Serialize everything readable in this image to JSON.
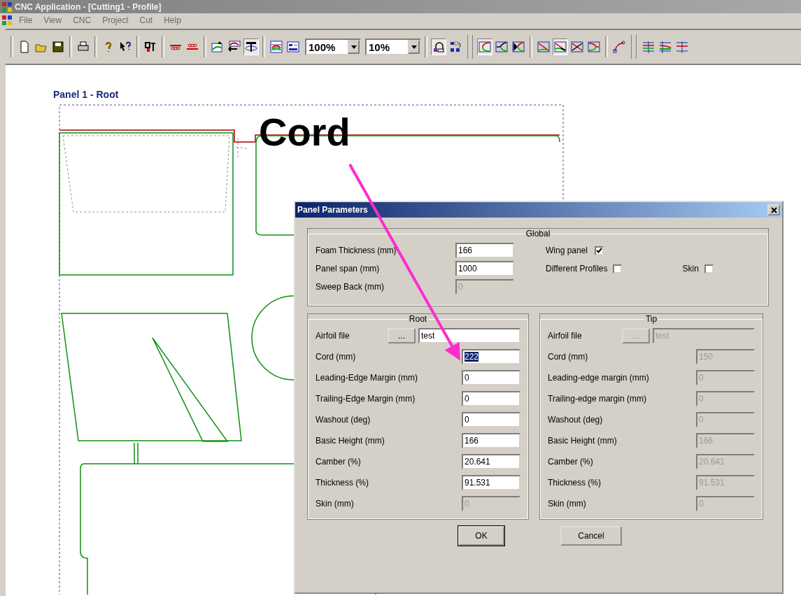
{
  "window": {
    "title": "CNC Application - [Cutting1 - Profile]"
  },
  "menu": [
    "File",
    "View",
    "CNC",
    "Project",
    "Cut",
    "Help"
  ],
  "toolbar": {
    "zoom": "100%",
    "step": "10%",
    "buttons": [
      {
        "pressed": false
      },
      {
        "pressed": false
      },
      {
        "pressed": false
      },
      {
        "pressed": false
      },
      {
        "pressed": false
      },
      {
        "pressed": false
      },
      {
        "pressed": false
      },
      {
        "pressed": false
      },
      {
        "pressed": false
      },
      {
        "pressed": false
      },
      {
        "pressed": false
      },
      {
        "pressed": true
      },
      {
        "pressed": false
      },
      {
        "pressed": false
      },
      {
        "pressed": true
      },
      {
        "pressed": false
      },
      {
        "pressed": true
      },
      {
        "pressed": false
      },
      {
        "pressed": false
      },
      {
        "pressed": false
      },
      {
        "pressed": true
      },
      {
        "pressed": false
      },
      {
        "pressed": false
      },
      {
        "pressed": false
      },
      {
        "pressed": false
      },
      {
        "pressed": false
      },
      {
        "pressed": false
      }
    ]
  },
  "canvas": {
    "panel_label": "Panel 1 - Root",
    "annotation": "Cord"
  },
  "dialog": {
    "title": "Panel Parameters",
    "global": {
      "title": "Global",
      "fields": [
        {
          "label": "Foam Thickness (mm)",
          "value": "166",
          "disabled": false
        },
        {
          "label": "Panel span (mm)",
          "value": "1000",
          "disabled": false
        },
        {
          "label": "Sweep Back (mm)",
          "value": "0",
          "disabled": true
        }
      ],
      "checks": [
        {
          "label": "Wing panel",
          "checked": true
        },
        {
          "label": "Different Profiles",
          "checked": false
        },
        {
          "label": "Skin",
          "checked": false
        }
      ]
    },
    "root": {
      "title": "Root",
      "airfoil": {
        "label": "Airfoil file",
        "button": "...",
        "value": "test",
        "disabled": false
      },
      "fields": [
        {
          "label": "Cord (mm)",
          "value": "222",
          "disabled": false,
          "highlighted": true
        },
        {
          "label": "Leading-Edge Margin (mm)",
          "value": "0",
          "disabled": false,
          "highlighted": false
        },
        {
          "label": "Trailing-Edge Margin (mm)",
          "value": "0",
          "disabled": false,
          "highlighted": false
        },
        {
          "label": "Washout (deg)",
          "value": "0",
          "disabled": false,
          "highlighted": false
        },
        {
          "label": "Basic Height (mm)",
          "value": "166",
          "disabled": false,
          "highlighted": false
        },
        {
          "label": "Camber (%)",
          "value": "20.641",
          "disabled": false,
          "highlighted": false
        },
        {
          "label": "Thickness (%)",
          "value": "91.531",
          "disabled": false,
          "highlighted": false
        },
        {
          "label": "Skin (mm)",
          "value": "0",
          "disabled": true,
          "highlighted": false
        }
      ]
    },
    "tip": {
      "title": "Tip",
      "airfoil": {
        "label": "Airfoil file",
        "button": "...",
        "value": "test",
        "disabled": true
      },
      "fields": [
        {
          "label": "Cord (mm)",
          "value": "150",
          "disabled": true,
          "highlighted": false
        },
        {
          "label": "Leading-edge margin (mm)",
          "value": "0",
          "disabled": true,
          "highlighted": false
        },
        {
          "label": "Trailing-edge margin (mm)",
          "value": "0",
          "disabled": true,
          "highlighted": false
        },
        {
          "label": "Washout (deg)",
          "value": "0",
          "disabled": true,
          "highlighted": false
        },
        {
          "label": "Basic Height (mm)",
          "value": "166",
          "disabled": true,
          "highlighted": false
        },
        {
          "label": "Camber (%)",
          "value": "20.641",
          "disabled": true,
          "highlighted": false
        },
        {
          "label": "Thickness (%)",
          "value": "91.531",
          "disabled": true,
          "highlighted": false
        },
        {
          "label": "Skin (mm)",
          "value": "0",
          "disabled": true,
          "highlighted": false
        }
      ]
    },
    "buttons": [
      "OK",
      "Cancel"
    ]
  }
}
